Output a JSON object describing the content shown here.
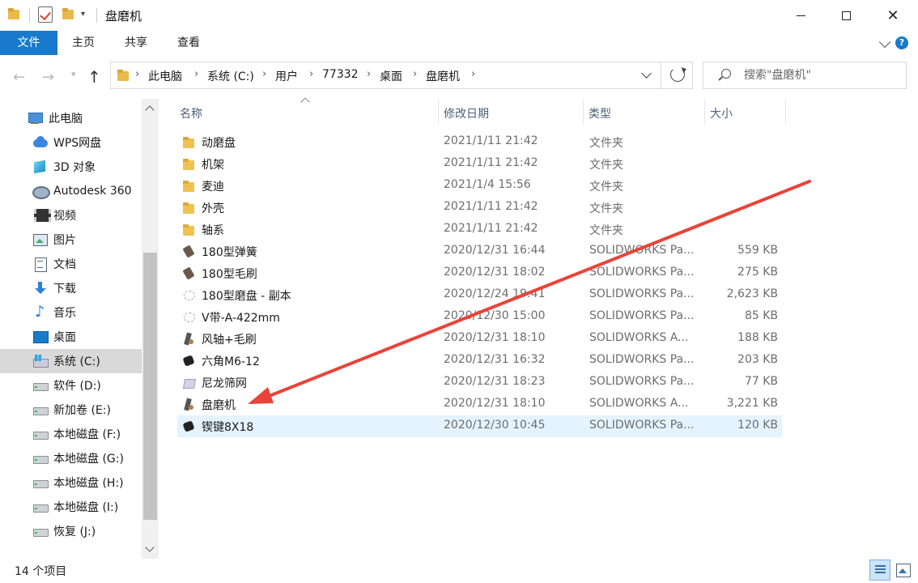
{
  "window": {
    "title": "盘磨机",
    "minimize_icon": "minimize-icon",
    "maximize_icon": "maximize-icon",
    "close_glyph": "✕"
  },
  "ribbon": {
    "tabs": [
      "文件",
      "主页",
      "共享",
      "查看"
    ],
    "active_color": "#1979ca"
  },
  "nav": {
    "back_glyph": "←",
    "forward_glyph": "→",
    "up_glyph": "↑",
    "breadcrumb": [
      "此电脑",
      "系统 (C:)",
      "用户",
      "77332",
      "桌面",
      "盘磨机"
    ],
    "crumb_sep": "›"
  },
  "search": {
    "placeholder": "搜索\"盘磨机\""
  },
  "sidebar": {
    "items": [
      {
        "label": "此电脑",
        "icon": "computer-icon",
        "selected": false
      },
      {
        "label": "WPS网盘",
        "icon": "cloud-icon",
        "selected": false
      },
      {
        "label": "3D 对象",
        "icon": "3d-objects-icon",
        "selected": false
      },
      {
        "label": "Autodesk 360",
        "icon": "autodesk-icon",
        "selected": false
      },
      {
        "label": "视频",
        "icon": "video-icon",
        "selected": false
      },
      {
        "label": "图片",
        "icon": "pictures-icon",
        "selected": false
      },
      {
        "label": "文档",
        "icon": "documents-icon",
        "selected": false
      },
      {
        "label": "下载",
        "icon": "download-icon",
        "selected": false
      },
      {
        "label": "音乐",
        "icon": "music-icon",
        "selected": false
      },
      {
        "label": "桌面",
        "icon": "desktop-icon",
        "selected": false
      },
      {
        "label": "系统 (C:)",
        "icon": "system-drive-icon",
        "selected": true
      },
      {
        "label": "软件 (D:)",
        "icon": "drive-icon",
        "selected": false
      },
      {
        "label": "新加卷 (E:)",
        "icon": "drive-icon",
        "selected": false
      },
      {
        "label": "本地磁盘 (F:)",
        "icon": "drive-icon",
        "selected": false
      },
      {
        "label": "本地磁盘 (G:)",
        "icon": "drive-icon",
        "selected": false
      },
      {
        "label": "本地磁盘 (H:)",
        "icon": "drive-icon",
        "selected": false
      },
      {
        "label": "本地磁盘 (I:)",
        "icon": "drive-icon",
        "selected": false
      },
      {
        "label": "恢复 (J:)",
        "icon": "drive-icon",
        "selected": false
      }
    ]
  },
  "columns": {
    "name": "名称",
    "date": "修改日期",
    "type": "类型",
    "size": "大小"
  },
  "files": [
    {
      "name": "动磨盘",
      "date": "2021/1/11 21:42",
      "type": "文件夹",
      "size": "",
      "icon": "folder-icon",
      "selected": false
    },
    {
      "name": "机架",
      "date": "2021/1/11 21:42",
      "type": "文件夹",
      "size": "",
      "icon": "folder-icon",
      "selected": false
    },
    {
      "name": "麦迪",
      "date": "2021/1/4 15:56",
      "type": "文件夹",
      "size": "",
      "icon": "folder-icon",
      "selected": false
    },
    {
      "name": "外壳",
      "date": "2021/1/11 21:42",
      "type": "文件夹",
      "size": "",
      "icon": "folder-icon",
      "selected": false
    },
    {
      "name": "轴系",
      "date": "2021/1/11 21:42",
      "type": "文件夹",
      "size": "",
      "icon": "folder-icon",
      "selected": false
    },
    {
      "name": "180型弹簧",
      "date": "2020/12/31 16:44",
      "type": "SOLIDWORKS Pa...",
      "size": "559 KB",
      "icon": "part-icon",
      "selected": false
    },
    {
      "name": "180型毛刷",
      "date": "2020/12/31 18:02",
      "type": "SOLIDWORKS Pa...",
      "size": "275 KB",
      "icon": "part-icon",
      "selected": false
    },
    {
      "name": "180型磨盘 - 副本",
      "date": "2020/12/24 19:41",
      "type": "SOLIDWORKS Pa...",
      "size": "2,623 KB",
      "icon": "part-light-icon",
      "selected": false
    },
    {
      "name": "V带-A-422mm",
      "date": "2020/12/30 15:00",
      "type": "SOLIDWORKS Pa...",
      "size": "85 KB",
      "icon": "part-light-icon",
      "selected": false
    },
    {
      "name": "风轴+毛刷",
      "date": "2020/12/31 18:10",
      "type": "SOLIDWORKS A...",
      "size": "188 KB",
      "icon": "assembly-icon",
      "selected": false
    },
    {
      "name": "六角M6-12",
      "date": "2020/12/31 16:32",
      "type": "SOLIDWORKS Pa...",
      "size": "203 KB",
      "icon": "part-dark-icon",
      "selected": false
    },
    {
      "name": "尼龙筛网",
      "date": "2020/12/31 18:23",
      "type": "SOLIDWORKS Pa...",
      "size": "77 KB",
      "icon": "part-mesh-icon",
      "selected": false
    },
    {
      "name": "盘磨机",
      "date": "2020/12/31 18:10",
      "type": "SOLIDWORKS A...",
      "size": "3,221 KB",
      "icon": "assembly-icon",
      "selected": false
    },
    {
      "name": "锲键8X18",
      "date": "2020/12/30 10:45",
      "type": "SOLIDWORKS Pa...",
      "size": "120 KB",
      "icon": "part-dark-icon",
      "selected": true
    }
  ],
  "status": {
    "item_count": "14 个项目"
  },
  "annotation": {
    "arrow_color": "#e8443a"
  }
}
